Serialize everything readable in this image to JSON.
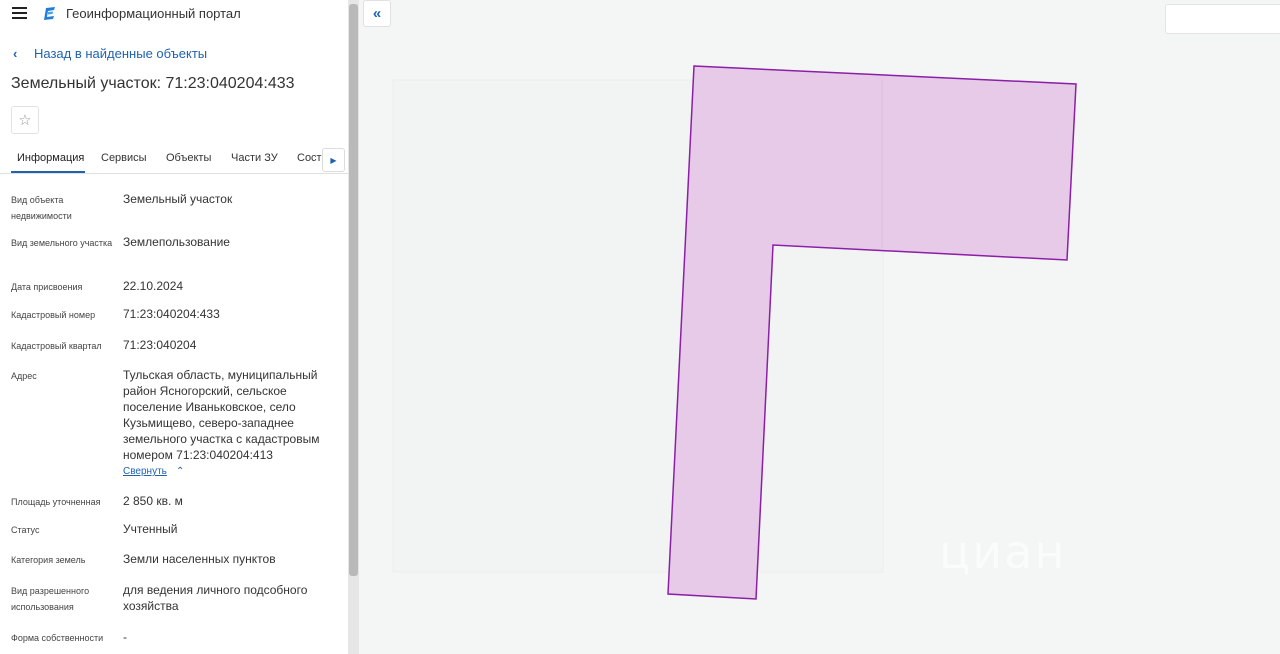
{
  "header": {
    "portal_title": "Геоинформационный портал"
  },
  "back_link": "Назад в найденные объекты",
  "object_title": "Земельный участок: 71:23:040204:433",
  "tabs": [
    {
      "label": "Информация",
      "active": true
    },
    {
      "label": "Сервисы"
    },
    {
      "label": "Объекты"
    },
    {
      "label": "Части ЗУ"
    },
    {
      "label": "Соста"
    }
  ],
  "properties": [
    {
      "label": "Вид объекта недвижимости",
      "value": "Земельный участок"
    },
    {
      "label": "Вид земельного участка",
      "value": "Землепользование"
    },
    {
      "label": "Дата присвоения",
      "value": "22.10.2024"
    },
    {
      "label": "Кадастровый номер",
      "value": "71:23:040204:433"
    },
    {
      "label": "Кадастровый квартал",
      "value": "71:23:040204"
    },
    {
      "label": "Адрес",
      "value": "Тульская область, муниципальный район Ясногорский, сельское поселение Иваньковское, село Кузьмищево, северо-западнее земельного участка с кадастровым номером 71:23:040204:413"
    },
    {
      "label": "Площадь уточненная",
      "value": "2 850 кв. м"
    },
    {
      "label": "Статус",
      "value": "Учтенный"
    },
    {
      "label": "Категория земель",
      "value": "Земли населенных пунктов"
    },
    {
      "label": "Вид разрешенного использования",
      "value": "для ведения личного подсобного хозяйства"
    },
    {
      "label": "Форма собственности",
      "value": "-"
    }
  ],
  "collapse_label": "Свернуть",
  "watermark": "циан",
  "colors": {
    "accent": "#1f62b0",
    "parcel_fill": "#e6cae8",
    "parcel_stroke": "#8b1fa8"
  },
  "icons": {
    "menu": "hamburger-icon",
    "logo": "portal-logo-icon",
    "back": "chevron-left-icon",
    "favorite": "star-outline-icon",
    "tab_scroll": "chevron-right-icon",
    "collapse": "double-chevron-left-icon"
  }
}
